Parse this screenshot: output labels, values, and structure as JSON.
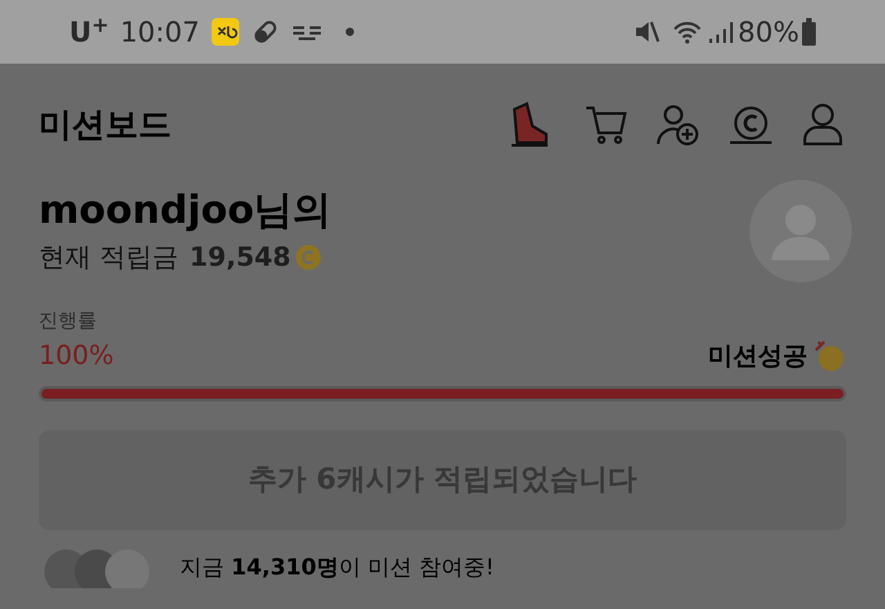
{
  "status_bar": {
    "carrier": "U$^{+}$",
    "time": "10:07",
    "battery": "80%"
  },
  "header": {
    "title": "미션보드"
  },
  "profile": {
    "name": "moondjoo님의",
    "balance_label": "현재 적립금",
    "balance": "19,548"
  },
  "progress": {
    "label": "진행률",
    "percent": "100%",
    "result": "미션성공",
    "level": 1
  },
  "reward_button": {
    "label": "추가 6캐시가 적립되었습니다",
    "disabled": true
  },
  "participants": {
    "text": "지금 **14,310명**이 미션 참여중!"
  }
}
